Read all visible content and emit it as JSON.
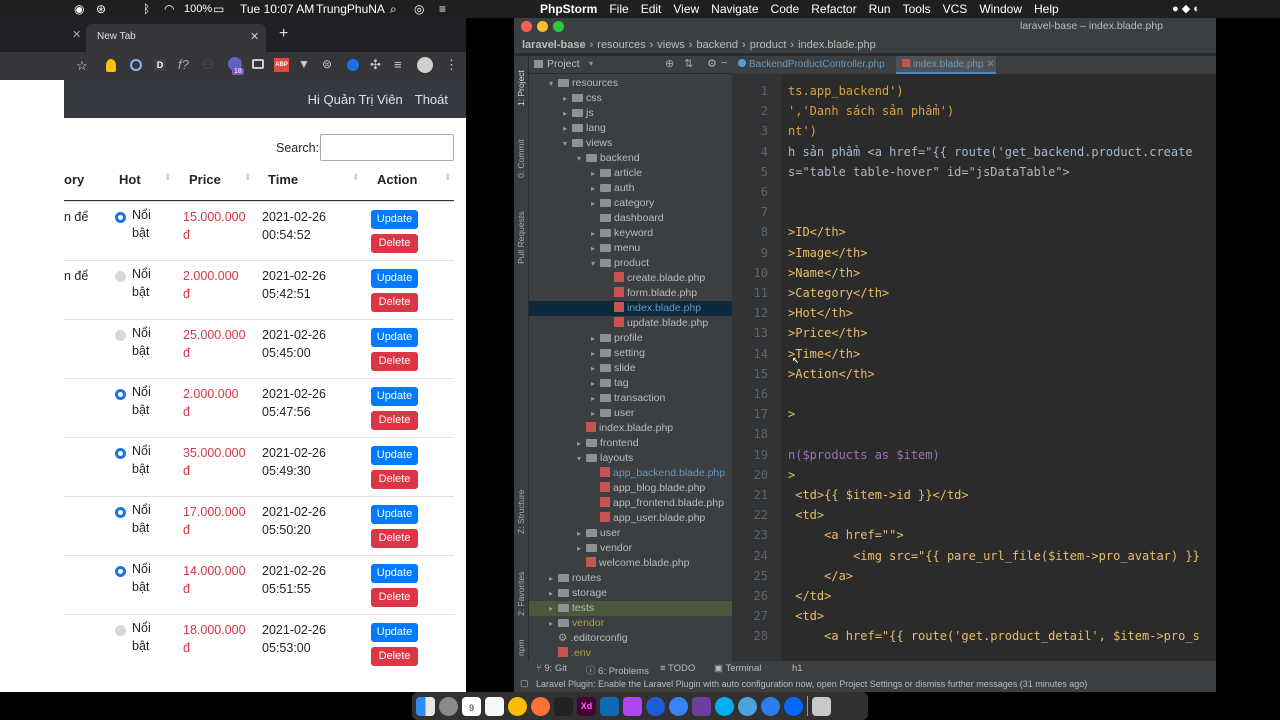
{
  "menubar": {
    "battery": "100%",
    "clock": "Tue 10:07 AM",
    "user": "TrungPhuNA",
    "apple_menu": [
      "PhpStorm",
      "File",
      "Edit",
      "View",
      "Navigate",
      "Code",
      "Refactor",
      "Run",
      "Tools",
      "VCS",
      "Window",
      "Help"
    ]
  },
  "browser": {
    "tab_title": "New Tab",
    "new_tab_symbol": "+",
    "badge_count": "18",
    "nav_links": [
      "Hi Quản Trị Viên",
      "Thoát"
    ],
    "search_label": "Search:",
    "search_value": "",
    "columns": [
      "ory",
      "Hot",
      "Price",
      "Time",
      "Action"
    ],
    "update_label": "Update",
    "delete_label": "Delete",
    "rows": [
      {
        "cat": "n để",
        "hot": true,
        "hot_label_1": "Nổi",
        "hot_label_2": "bật",
        "price_1": "15.000.000",
        "price_2": "đ",
        "date": "2021-02-26",
        "time": "00:54:52"
      },
      {
        "cat": "n để",
        "hot": false,
        "hot_label_1": "Nổi",
        "hot_label_2": "bật",
        "price_1": "2.000.000",
        "price_2": "đ",
        "date": "2021-02-26",
        "time": "05:42:51"
      },
      {
        "cat": "",
        "hot": false,
        "hot_label_1": "Nổi",
        "hot_label_2": "bật",
        "price_1": "25.000.000",
        "price_2": "đ",
        "date": "2021-02-26",
        "time": "05:45:00"
      },
      {
        "cat": "",
        "hot": true,
        "hot_label_1": "Nổi",
        "hot_label_2": "bật",
        "price_1": "2.000.000",
        "price_2": "đ",
        "date": "2021-02-26",
        "time": "05:47:56"
      },
      {
        "cat": "",
        "hot": true,
        "hot_label_1": "Nổi",
        "hot_label_2": "bật",
        "price_1": "35.000.000",
        "price_2": "đ",
        "date": "2021-02-26",
        "time": "05:49:30"
      },
      {
        "cat": "",
        "hot": true,
        "hot_label_1": "Nổi",
        "hot_label_2": "bật",
        "price_1": "17.000.000",
        "price_2": "đ",
        "date": "2021-02-26",
        "time": "05:50:20"
      },
      {
        "cat": "",
        "hot": true,
        "hot_label_1": "Nổi",
        "hot_label_2": "bật",
        "price_1": "14.000.000",
        "price_2": "đ",
        "date": "2021-02-26",
        "time": "05:51:55"
      },
      {
        "cat": "",
        "hot": false,
        "hot_label_1": "Nổi",
        "hot_label_2": "bật",
        "price_1": "18.000.000",
        "price_2": "đ",
        "date": "2021-02-26",
        "time": "05:53:00"
      }
    ]
  },
  "ide": {
    "window_title": "laravel-base – index.blade.php",
    "breadcrumbs": [
      "laravel-base",
      "resources",
      "views",
      "backend",
      "product",
      "index.blade.php"
    ],
    "project_label": "Project",
    "tabs": [
      "BackendProductController.php",
      "index.blade.php"
    ],
    "side_tools": [
      "1: Project",
      "0: Commit",
      "Pull Requests",
      "Z: Structure",
      "2: Favorites",
      "npm"
    ],
    "tree": [
      {
        "label": "resources",
        "type": "folder",
        "arrow": "▾"
      },
      {
        "label": "css",
        "type": "folder",
        "arrow": "▸"
      },
      {
        "label": "js",
        "type": "folder",
        "arrow": "▸"
      },
      {
        "label": "lang",
        "type": "folder",
        "arrow": "▸"
      },
      {
        "label": "views",
        "type": "folder",
        "arrow": "▾"
      },
      {
        "label": "backend",
        "type": "folder",
        "arrow": "▾"
      },
      {
        "label": "article",
        "type": "folder",
        "arrow": "▸"
      },
      {
        "label": "auth",
        "type": "folder",
        "arrow": "▸"
      },
      {
        "label": "category",
        "type": "folder",
        "arrow": "▸"
      },
      {
        "label": "dashboard",
        "type": "folder",
        "arrow": ""
      },
      {
        "label": "keyword",
        "type": "folder",
        "arrow": "▸"
      },
      {
        "label": "menu",
        "type": "folder",
        "arrow": "▸"
      },
      {
        "label": "product",
        "type": "folder",
        "arrow": "▾"
      },
      {
        "label": "create.blade.php",
        "type": "file",
        "arrow": ""
      },
      {
        "label": "form.blade.php",
        "type": "file",
        "arrow": ""
      },
      {
        "label": "index.blade.php",
        "type": "file",
        "arrow": ""
      },
      {
        "label": "update.blade.php",
        "type": "file",
        "arrow": ""
      },
      {
        "label": "profile",
        "type": "folder",
        "arrow": "▸"
      },
      {
        "label": "setting",
        "type": "folder",
        "arrow": "▸"
      },
      {
        "label": "slide",
        "type": "folder",
        "arrow": "▸"
      },
      {
        "label": "tag",
        "type": "folder",
        "arrow": "▸"
      },
      {
        "label": "transaction",
        "type": "folder",
        "arrow": "▸"
      },
      {
        "label": "user",
        "type": "folder",
        "arrow": "▸"
      },
      {
        "label": "index.blade.php",
        "type": "file",
        "arrow": ""
      },
      {
        "label": "frontend",
        "type": "folder",
        "arrow": "▸"
      },
      {
        "label": "layouts",
        "type": "folder",
        "arrow": "▾"
      },
      {
        "label": "app_backend.blade.php",
        "type": "file",
        "arrow": ""
      },
      {
        "label": "app_blog.blade.php",
        "type": "file",
        "arrow": ""
      },
      {
        "label": "app_frontend.blade.php",
        "type": "file",
        "arrow": ""
      },
      {
        "label": "app_user.blade.php",
        "type": "file",
        "arrow": ""
      },
      {
        "label": "user",
        "type": "folder",
        "arrow": "▸"
      },
      {
        "label": "vendor",
        "type": "folder",
        "arrow": "▸"
      },
      {
        "label": "welcome.blade.php",
        "type": "file",
        "arrow": ""
      },
      {
        "label": "routes",
        "type": "folder",
        "arrow": "▸"
      },
      {
        "label": "storage",
        "type": "folder",
        "arrow": "▸"
      },
      {
        "label": "tests",
        "type": "folder",
        "arrow": "▸"
      },
      {
        "label": "vendor",
        "type": "folder",
        "arrow": "▸"
      },
      {
        "label": ".editorconfig",
        "type": "gear",
        "arrow": ""
      },
      {
        "label": ".env",
        "type": "file",
        "arrow": ""
      }
    ],
    "code_lines": [
      {
        "n": "1",
        "t": "ts.app_backend')"
      },
      {
        "n": "2",
        "t": "','Danh sách sản phẩm')"
      },
      {
        "n": "3",
        "t": "nt')"
      },
      {
        "n": "4",
        "t": "h sản phẩm <a href=\"{{ route('get_backend.product.create"
      },
      {
        "n": "5",
        "t": "s=\"table table-hover\" id=\"jsDataTable\">"
      },
      {
        "n": "6",
        "t": ""
      },
      {
        "n": "7",
        "t": ""
      },
      {
        "n": "8",
        "t": ">ID</th>"
      },
      {
        "n": "9",
        "t": ">Image</th>"
      },
      {
        "n": "10",
        "t": ">Name</th>"
      },
      {
        "n": "11",
        "t": ">Category</th>"
      },
      {
        "n": "12",
        "t": ">Hot</th>"
      },
      {
        "n": "13",
        "t": ">Price</th>"
      },
      {
        "n": "14",
        "t": ">Time</th>"
      },
      {
        "n": "15",
        "t": ">Action</th>"
      },
      {
        "n": "16",
        "t": ""
      },
      {
        "n": "17",
        "t": ">"
      },
      {
        "n": "18",
        "t": ""
      },
      {
        "n": "19",
        "t": "n($products as $item)"
      },
      {
        "n": "20",
        "t": ">"
      },
      {
        "n": "21",
        "t": " <td>{{ $item->id }}</td>"
      },
      {
        "n": "22",
        "t": " <td>"
      },
      {
        "n": "23",
        "t": "     <a href=\"\">"
      },
      {
        "n": "24",
        "t": "         <img src=\"{{ pare_url_file($item->pro_avatar) }}"
      },
      {
        "n": "25",
        "t": "     </a>"
      },
      {
        "n": "26",
        "t": " </td>"
      },
      {
        "n": "27",
        "t": " <td>"
      },
      {
        "n": "28",
        "t": "     <a href=\"{{ route('get.product_detail', $item->pro_s"
      }
    ],
    "crumb_bottom": "h1",
    "bottom_tools": [
      "9: Git",
      "6: Problems",
      "TODO",
      "Terminal"
    ],
    "status_message": "Laravel Plugin: Enable the Laravel Plugin with auto configuration now, open Project Settings or dismiss further messages (31 minutes ago)"
  },
  "dock": {
    "calendar_day": "9"
  }
}
